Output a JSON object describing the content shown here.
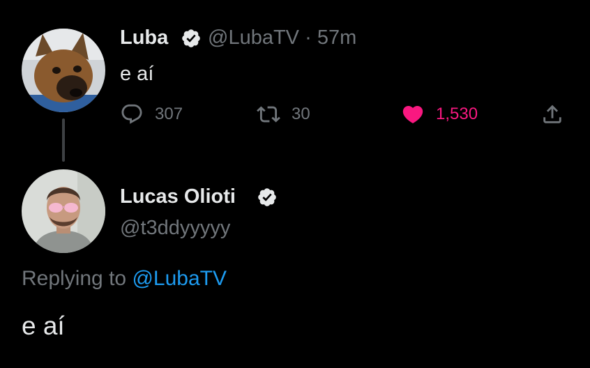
{
  "tweet": {
    "author_name": "Luba",
    "handle": "@LubaTV",
    "separator": "·",
    "time": "57m",
    "text": "e aí",
    "actions": {
      "reply_count": "307",
      "retweet_count": "30",
      "like_count": "1,530"
    }
  },
  "reply": {
    "author_name": "Lucas Olioti",
    "handle": "@t3ddyyyyy",
    "replying_label": "Replying to",
    "replying_to": "@LubaTV",
    "text": "e aí"
  },
  "icons": {
    "reply": "speech-bubble-icon",
    "retweet": "retweet-arrows-icon",
    "like": "heart-icon (filled, liked)",
    "share": "share-upload-icon",
    "verified": "verified-badge-icon"
  },
  "colors": {
    "background": "#000000",
    "primary_text": "#e7e9ea",
    "secondary_text": "#71767b",
    "link": "#1d9bf0",
    "like": "#f91880"
  }
}
